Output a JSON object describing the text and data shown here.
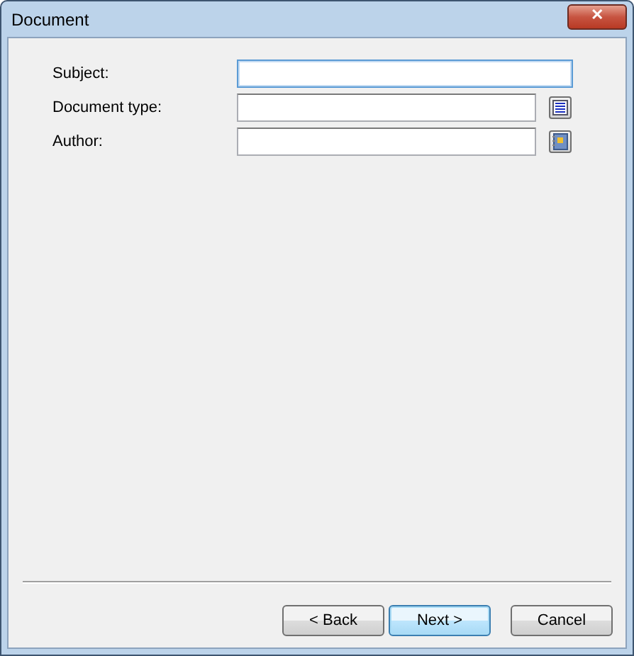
{
  "window": {
    "title": "Document",
    "close_glyph": "✕"
  },
  "fields": [
    {
      "label": "Subject:",
      "focused": true,
      "kind": "plain"
    },
    {
      "label": "Document type:",
      "focused": false,
      "kind": "list"
    },
    {
      "label": "Author:",
      "focused": false,
      "kind": "book"
    }
  ],
  "buttons": [
    {
      "label": "< Back",
      "default": false
    },
    {
      "label": "Next >",
      "default": true
    },
    {
      "label": "Cancel",
      "default": false
    }
  ]
}
